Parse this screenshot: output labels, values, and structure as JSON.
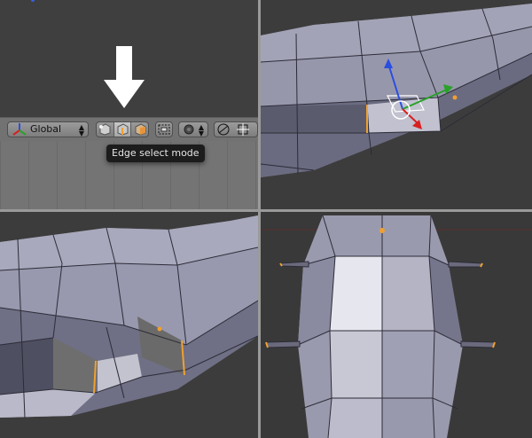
{
  "header": {
    "orientation_label": "Global",
    "selection_modes": [
      "vertex-select",
      "edge-select",
      "face-select"
    ],
    "active_mode": "edge-select"
  },
  "tooltip": {
    "text": "Edge select mode"
  },
  "colors": {
    "viewport_bg": "#3c3c3c",
    "header_bg": "#727272",
    "mesh_face": "#8e8ea4",
    "selection_orange": "#f0a030",
    "gizmo_x": "#d82020",
    "gizmo_y": "#2aa12a",
    "gizmo_z": "#2a4ee0"
  }
}
